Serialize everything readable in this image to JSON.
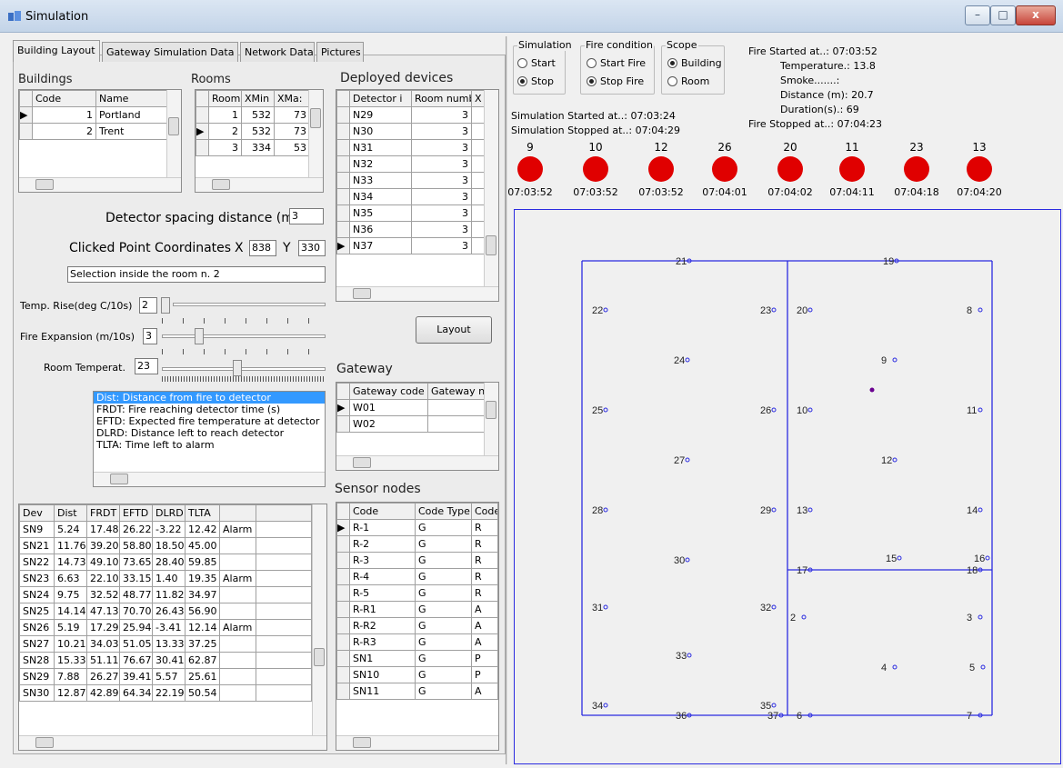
{
  "window": {
    "title": "Simulation",
    "min": "–",
    "max": "□",
    "close": "x"
  },
  "tabs": [
    "Building Layout",
    "Gateway Simulation Data",
    "Network Data",
    "Pictures"
  ],
  "buildings": {
    "label": "Buildings",
    "headers": [
      "Code",
      "Name"
    ],
    "rows": [
      [
        "1",
        "Portland"
      ],
      [
        "2",
        "Trent"
      ]
    ]
  },
  "rooms": {
    "label": "Rooms",
    "headers": [
      "Room",
      "XMin",
      "XMa:"
    ],
    "rows": [
      [
        "1",
        "532",
        "73"
      ],
      [
        "2",
        "532",
        "73"
      ],
      [
        "3",
        "334",
        "53"
      ]
    ]
  },
  "settings": {
    "spacing_label": "Detector spacing distance (m)",
    "spacing_value": "3",
    "coords_label": "Clicked Point Coordinates",
    "x_label": "X",
    "x_value": "838",
    "y_label": "Y",
    "y_value": "330",
    "selection_text": "Selection  inside  the room n. 2",
    "temp_rise_label": "Temp. Rise(deg C/10s)",
    "temp_rise_value": "2",
    "fire_exp_label": "Fire Expansion (m/10s)",
    "fire_exp_value": "3",
    "room_temp_label": "Room Temperat.",
    "room_temp_value": "23"
  },
  "legend": [
    "Dist: Distance from fire to detector",
    "FRDT: Fire reaching detector time (s)",
    "EFTD: Expected fire temperature at detector",
    "DLRD: Distance left to reach detector",
    "TLTA: Time left to alarm"
  ],
  "dev_table": {
    "headers": [
      "Dev",
      "Dist",
      "FRDT",
      "EFTD",
      "DLRD",
      "TLTA",
      ""
    ],
    "rows": [
      [
        "SN9",
        "5.24",
        "17.48",
        "26.22",
        "-3.22",
        "12.42",
        "Alarm"
      ],
      [
        "SN21",
        "11.76",
        "39.20",
        "58.80",
        "18.50",
        "45.00",
        ""
      ],
      [
        "SN22",
        "14.73",
        "49.10",
        "73.65",
        "28.40",
        "59.85",
        ""
      ],
      [
        "SN23",
        "6.63",
        "22.10",
        "33.15",
        "1.40",
        "19.35",
        "Alarm"
      ],
      [
        "SN24",
        "9.75",
        "32.52",
        "48.77",
        "11.82",
        "34.97",
        ""
      ],
      [
        "SN25",
        "14.14",
        "47.13",
        "70.70",
        "26.43",
        "56.90",
        ""
      ],
      [
        "SN26",
        "5.19",
        "17.29",
        "25.94",
        "-3.41",
        "12.14",
        "Alarm"
      ],
      [
        "SN27",
        "10.21",
        "34.03",
        "51.05",
        "13.33",
        "37.25",
        ""
      ],
      [
        "SN28",
        "15.33",
        "51.11",
        "76.67",
        "30.41",
        "62.87",
        ""
      ],
      [
        "SN29",
        "7.88",
        "26.27",
        "39.41",
        "5.57",
        "25.61",
        ""
      ],
      [
        "SN30",
        "12.87",
        "42.89",
        "64.34",
        "22.19",
        "50.54",
        ""
      ]
    ]
  },
  "deployed": {
    "label": "Deployed devices",
    "headers": [
      "Detector i",
      "Room number",
      "X"
    ],
    "rows": [
      [
        "N29",
        "3"
      ],
      [
        "N30",
        "3"
      ],
      [
        "N31",
        "3"
      ],
      [
        "N32",
        "3"
      ],
      [
        "N33",
        "3"
      ],
      [
        "N34",
        "3"
      ],
      [
        "N35",
        "3"
      ],
      [
        "N36",
        "3"
      ],
      [
        "N37",
        "3"
      ]
    ]
  },
  "layout_button": "Layout",
  "gateway": {
    "label": "Gateway",
    "headers": [
      "Gateway code",
      "Gateway n"
    ],
    "rows": [
      [
        "W01",
        ""
      ],
      [
        "W02",
        ""
      ]
    ]
  },
  "sensor_nodes": {
    "label": "Sensor nodes",
    "headers": [
      "Code",
      "Code Type",
      "Code"
    ],
    "rows": [
      [
        "R-1",
        "G",
        "R"
      ],
      [
        "R-2",
        "G",
        "R"
      ],
      [
        "R-3",
        "G",
        "R"
      ],
      [
        "R-4",
        "G",
        "R"
      ],
      [
        "R-5",
        "G",
        "R"
      ],
      [
        "R-R1",
        "G",
        "A"
      ],
      [
        "R-R2",
        "G",
        "A"
      ],
      [
        "R-R3",
        "G",
        "A"
      ],
      [
        "SN1",
        "G",
        "P"
      ],
      [
        "SN10",
        "G",
        "P"
      ],
      [
        "SN11",
        "G",
        "A"
      ]
    ]
  },
  "simulation": {
    "label": "Simulation",
    "start": "Start",
    "stop": "Stop"
  },
  "fire_condition": {
    "label": "Fire condition",
    "start": "Start Fire",
    "stop": "Stop Fire"
  },
  "scope": {
    "label": "Scope",
    "building": "Building",
    "room": "Room"
  },
  "status": {
    "fire_started": "Fire Started at..: 07:03:52",
    "temperature": "Temperature.: 13.8",
    "smoke": "Smoke.......:",
    "distance": "Distance (m): 20.7",
    "duration": "Duration(s).: 69",
    "fire_stopped": "Fire Stopped at..: 07:04:23",
    "sim_started": "Simulation Started at..: 07:03:24",
    "sim_stopped": "Simulation Stopped at..: 07:04:29"
  },
  "alarms": [
    {
      "id": "9",
      "time": "07:03:52"
    },
    {
      "id": "10",
      "time": "07:03:52"
    },
    {
      "id": "12",
      "time": "07:03:52"
    },
    {
      "id": "26",
      "time": "07:04:01"
    },
    {
      "id": "20",
      "time": "07:04:02"
    },
    {
      "id": "11",
      "time": "07:04:11"
    },
    {
      "id": "23",
      "time": "07:04:18"
    },
    {
      "id": "13",
      "time": "07:04:20"
    }
  ],
  "colors": {
    "alarm": "#e00000",
    "plan_line": "#2b2be0",
    "highlight": "#3399ff"
  }
}
